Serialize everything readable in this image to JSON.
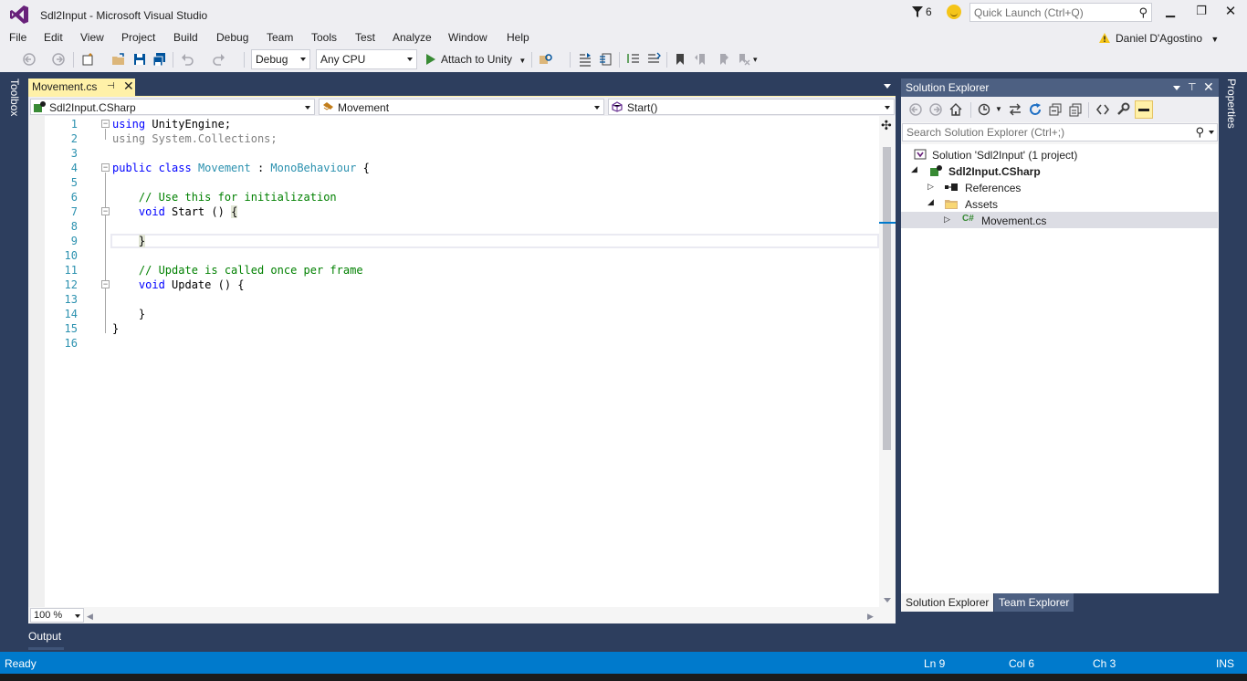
{
  "window": {
    "title": "Sdl2Input - Microsoft Visual Studio",
    "notification_count": "6",
    "quick_launch_placeholder": "Quick Launch (Ctrl+Q)",
    "user_name": "Daniel D'Agostino",
    "accent_color": "#007acc",
    "logo_color": "#68217a"
  },
  "menu": [
    "File",
    "Edit",
    "View",
    "Project",
    "Build",
    "Debug",
    "Team",
    "Tools",
    "Test",
    "Analyze",
    "Window",
    "Help"
  ],
  "toolbar": {
    "configuration": "Debug",
    "platform": "Any CPU",
    "attach_label": "Attach to Unity"
  },
  "side_strips": {
    "left": "Toolbox",
    "right": "Properties"
  },
  "editor": {
    "tab": {
      "label": "Movement.cs",
      "pinned": false
    },
    "nav": {
      "project": "Sdl2Input.CSharp",
      "type": "Movement",
      "member": "Start()"
    },
    "line_numbers": [
      "1",
      "2",
      "3",
      "4",
      "5",
      "6",
      "7",
      "8",
      "9",
      "10",
      "11",
      "12",
      "13",
      "14",
      "15",
      "16"
    ],
    "current_line": 9,
    "zoom": "100 %"
  },
  "output_tab": "Output",
  "solution_explorer": {
    "title": "Solution Explorer",
    "search_placeholder": "Search Solution Explorer (Ctrl+;)",
    "tree": [
      {
        "label": "Solution 'Sdl2Input' (1 project)",
        "icon": "solution-icon",
        "depth": 0
      },
      {
        "label": "Sdl2Input.CSharp",
        "icon": "csharp-project-icon",
        "depth": 1,
        "bold": true
      },
      {
        "label": "References",
        "icon": "references-icon",
        "depth": 2
      },
      {
        "label": "Assets",
        "icon": "folder-icon",
        "depth": 2
      },
      {
        "label": "Movement.cs",
        "icon": "csharp-file-icon",
        "depth": 3,
        "selected": true
      }
    ],
    "bottom_tabs": [
      "Solution Explorer",
      "Team Explorer"
    ]
  },
  "status": {
    "state": "Ready",
    "line": "Ln 9",
    "col": "Col 6",
    "ch": "Ch 3",
    "mode": "INS"
  }
}
